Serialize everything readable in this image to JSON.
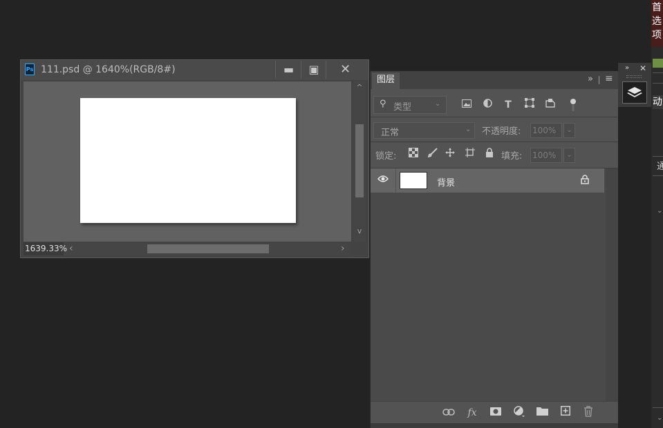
{
  "document_window": {
    "title": "111.psd @ 1640%(RGB/8#)",
    "app_icon_text": "Ps",
    "minimize_glyph": "▬",
    "maximize_glyph": "▣",
    "close_glyph": "✕",
    "zoom_level": "1639.33%",
    "scroll_up_glyph": "^",
    "scroll_down_glyph": "v",
    "scroll_left_glyph": "‹",
    "scroll_right_glyph": "›"
  },
  "layers_panel": {
    "tab_label": "图层",
    "collapse_glyph": "»",
    "menu_glyph": "≡",
    "filter": {
      "search_glyph": "⚲",
      "kind_label": "类型",
      "chevron": "⌄",
      "icons": [
        "image-filter",
        "adjustment-filter",
        "type-filter",
        "shape-filter",
        "smart-object-filter",
        "filter-toggle"
      ]
    },
    "blend_mode": "正常",
    "blend_chevron": "⌄",
    "opacity_label": "不透明度:",
    "opacity_value": "100%",
    "lock_label": "锁定:",
    "fill_label": "填充:",
    "fill_value": "100%",
    "dropdown_glyph": "⌄",
    "layers": [
      {
        "name": "背景",
        "visible": true,
        "locked": true
      }
    ],
    "footer_icons": [
      "link-layers",
      "fx",
      "add-mask",
      "new-adjustment",
      "new-group",
      "new-layer",
      "delete-layer"
    ]
  },
  "dock": {
    "expand_glyph": "»",
    "close_glyph": "✕",
    "layers_button_icon": "layers-icon"
  },
  "right_edge": {
    "prefs_chars": [
      "首",
      "选",
      "项"
    ],
    "anim_char": "动",
    "pass_char": "通"
  },
  "colors": {
    "workspace_bg": "#232323",
    "panel_bg": "#535353",
    "selected_layer": "#656565",
    "canvas_white": "#ffffff",
    "ps_icon_blue": "#31a8ff"
  }
}
